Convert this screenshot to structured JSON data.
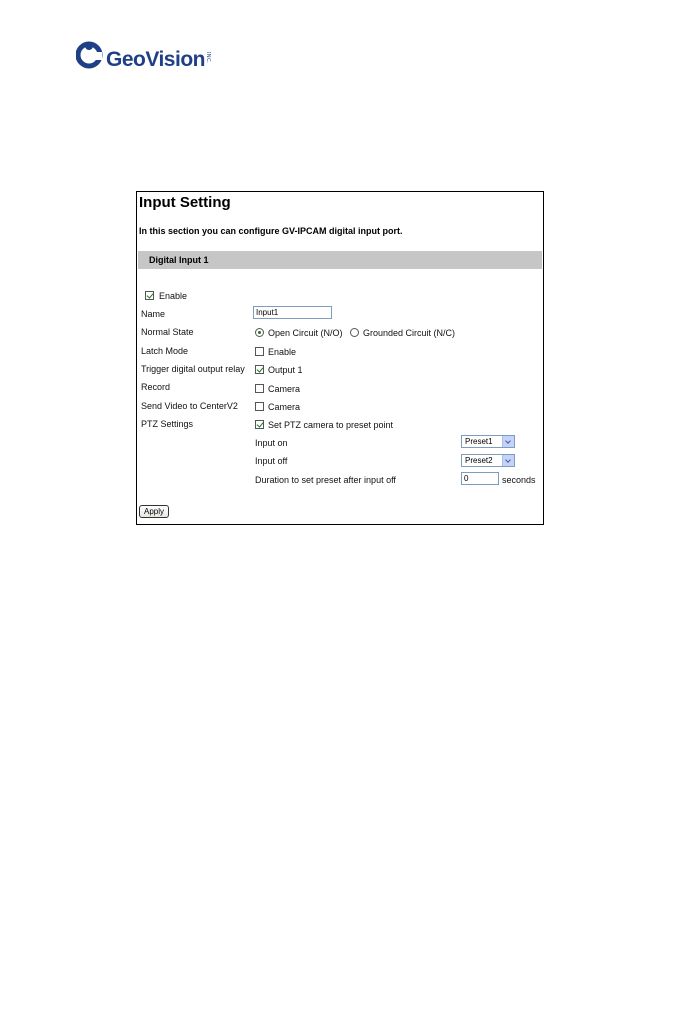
{
  "brand": {
    "name": "GeoVision",
    "suffix": "INC."
  },
  "page": {
    "title": "Input Setting",
    "description": "In this section you can configure GV-IPCAM digital input port.",
    "section_title": "Digital Input 1"
  },
  "form": {
    "enable_label": "Enable",
    "name_label": "Name",
    "name_value": "Input1",
    "normal_state_label": "Normal State",
    "normal_state_options": [
      "Open Circuit (N/O)",
      "Grounded Circuit (N/C)"
    ],
    "latch_mode_label": "Latch Mode",
    "latch_enable_label": "Enable",
    "trigger_label": "Trigger digital output relay",
    "trigger_option_label": "Output 1",
    "record_label": "Record",
    "record_option_label": "Camera",
    "send_video_label": "Send Video to CenterV2",
    "send_video_option_label": "Camera",
    "ptz_label": "PTZ Settings",
    "ptz_option_label": "Set PTZ camera to preset point",
    "input_on_label": "Input on",
    "input_on_value": "Preset1",
    "input_off_label": "Input off",
    "input_off_value": "Preset2",
    "duration_label": "Duration to set preset after input off",
    "duration_value": "0",
    "duration_unit": "seconds",
    "apply_label": "Apply"
  },
  "colors": {
    "brand": "#1f3f86",
    "section_bar": "#c6c6c6",
    "check": "#1a7a1a"
  }
}
